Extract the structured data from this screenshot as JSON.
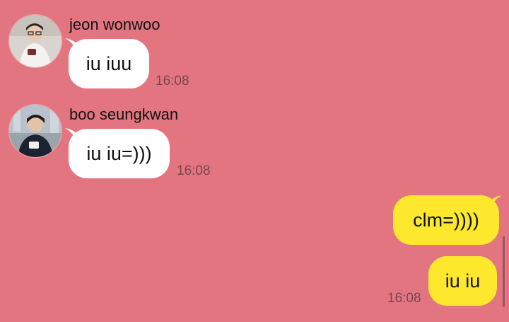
{
  "theme": {
    "background": "#e37580",
    "incoming_bubble": "#ffffff",
    "outgoing_bubble": "#fde82e"
  },
  "messages": [
    {
      "sender": "jeon wonwoo",
      "avatar_icon": "profile-photo-icon",
      "text": "iu iuu",
      "time": "16:08"
    },
    {
      "sender": "boo seungkwan",
      "avatar_icon": "profile-photo-icon",
      "text": "iu iu=)))",
      "time": "16:08"
    },
    {
      "text": "clm=))))"
    },
    {
      "text": "iu iu",
      "time": "16:08"
    }
  ]
}
